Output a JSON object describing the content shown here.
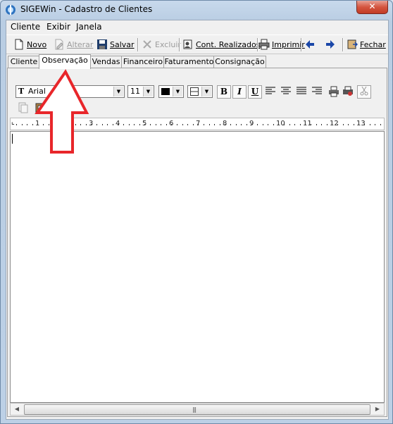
{
  "window": {
    "title": "SIGEWin - Cadastro de Clientes",
    "close_label": "✕"
  },
  "menu": [
    "Cliente",
    "Exibir",
    "Janela"
  ],
  "toolbar": {
    "novo": "Novo",
    "alterar": "Alterar",
    "salvar": "Salvar",
    "excluir": "Excluir",
    "cont_realizados": "Cont. Realizados",
    "imprimir": "Imprimir",
    "fechar": "Fechar"
  },
  "tabs": [
    "Cliente",
    "Observação",
    "Vendas",
    "Financeiro",
    "Faturamento",
    "Consignação"
  ],
  "active_tab": "Observação",
  "format": {
    "font": "Arial",
    "size": "11",
    "bold": "B",
    "italic": "I",
    "underline": "U"
  },
  "ruler": [
    "1",
    "2",
    "3",
    "4",
    "5",
    "6",
    "7",
    "8",
    "9",
    "10",
    "11",
    "12",
    "13"
  ],
  "colors": {
    "annotation_arrow": "#e8262a",
    "text_color_swatch": "#000000"
  },
  "icons": [
    "app-icon",
    "new-document-icon",
    "edit-icon",
    "save-disk-icon",
    "delete-x-icon",
    "contacts-icon",
    "printer-icon",
    "arrow-left-icon",
    "arrow-right-icon",
    "close-door-icon"
  ]
}
